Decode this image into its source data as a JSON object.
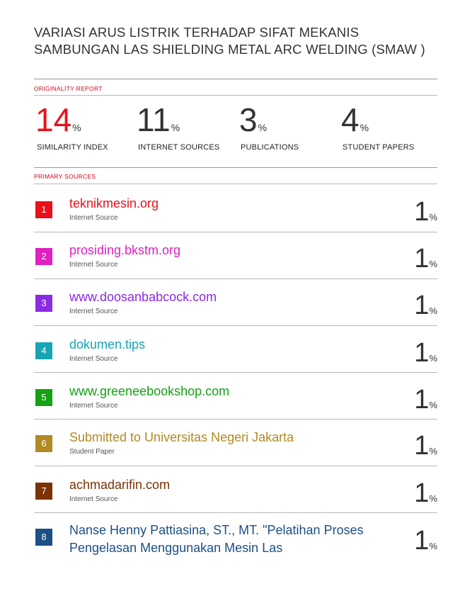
{
  "document": {
    "title": "VARIASI ARUS LISTRIK TERHADAP SIFAT MEKANIS SAMBUNGAN LAS SHIELDING METAL ARC WELDING (SMAW )"
  },
  "originality_report": {
    "label": "ORIGINALITY REPORT",
    "stats": [
      {
        "value": "14",
        "unit": "%",
        "label": "SIMILARITY INDEX",
        "color": "#e8111b"
      },
      {
        "value": "11",
        "unit": "%",
        "label": "INTERNET SOURCES",
        "color": "#333333"
      },
      {
        "value": "3",
        "unit": "%",
        "label": "PUBLICATIONS",
        "color": "#333333"
      },
      {
        "value": "4",
        "unit": "%",
        "label": "STUDENT PAPERS",
        "color": "#333333"
      }
    ]
  },
  "primary_sources": {
    "label": "PRIMARY SOURCES",
    "items": [
      {
        "rank": "1",
        "name": "teknikmesin.org",
        "type": "Internet Source",
        "score": "1",
        "unit": "%",
        "color": "#e8111b"
      },
      {
        "rank": "2",
        "name": "prosiding.bkstm.org",
        "type": "Internet Source",
        "score": "1",
        "unit": "%",
        "color": "#e020c0"
      },
      {
        "rank": "3",
        "name": "www.doosanbabcock.com",
        "type": "Internet Source",
        "score": "1",
        "unit": "%",
        "color": "#8a2be2"
      },
      {
        "rank": "4",
        "name": "dokumen.tips",
        "type": "Internet Source",
        "score": "1",
        "unit": "%",
        "color": "#17a5b5"
      },
      {
        "rank": "5",
        "name": "www.greeneebookshop.com",
        "type": "Internet Source",
        "score": "1",
        "unit": "%",
        "color": "#16a016"
      },
      {
        "rank": "6",
        "name": "Submitted to Universitas Negeri Jakarta",
        "type": "Student Paper",
        "score": "1",
        "unit": "%",
        "color": "#b08a22"
      },
      {
        "rank": "7",
        "name": "achmadarifin.com",
        "type": "Internet Source",
        "score": "1",
        "unit": "%",
        "color": "#7a3206"
      },
      {
        "rank": "8",
        "name": "Nanse Henny Pattiasina, ST., MT. \"Pelatihan Proses Pengelasan Menggunakan Mesin Las",
        "type": "",
        "score": "1",
        "unit": "%",
        "color": "#1d4f86"
      }
    ]
  }
}
